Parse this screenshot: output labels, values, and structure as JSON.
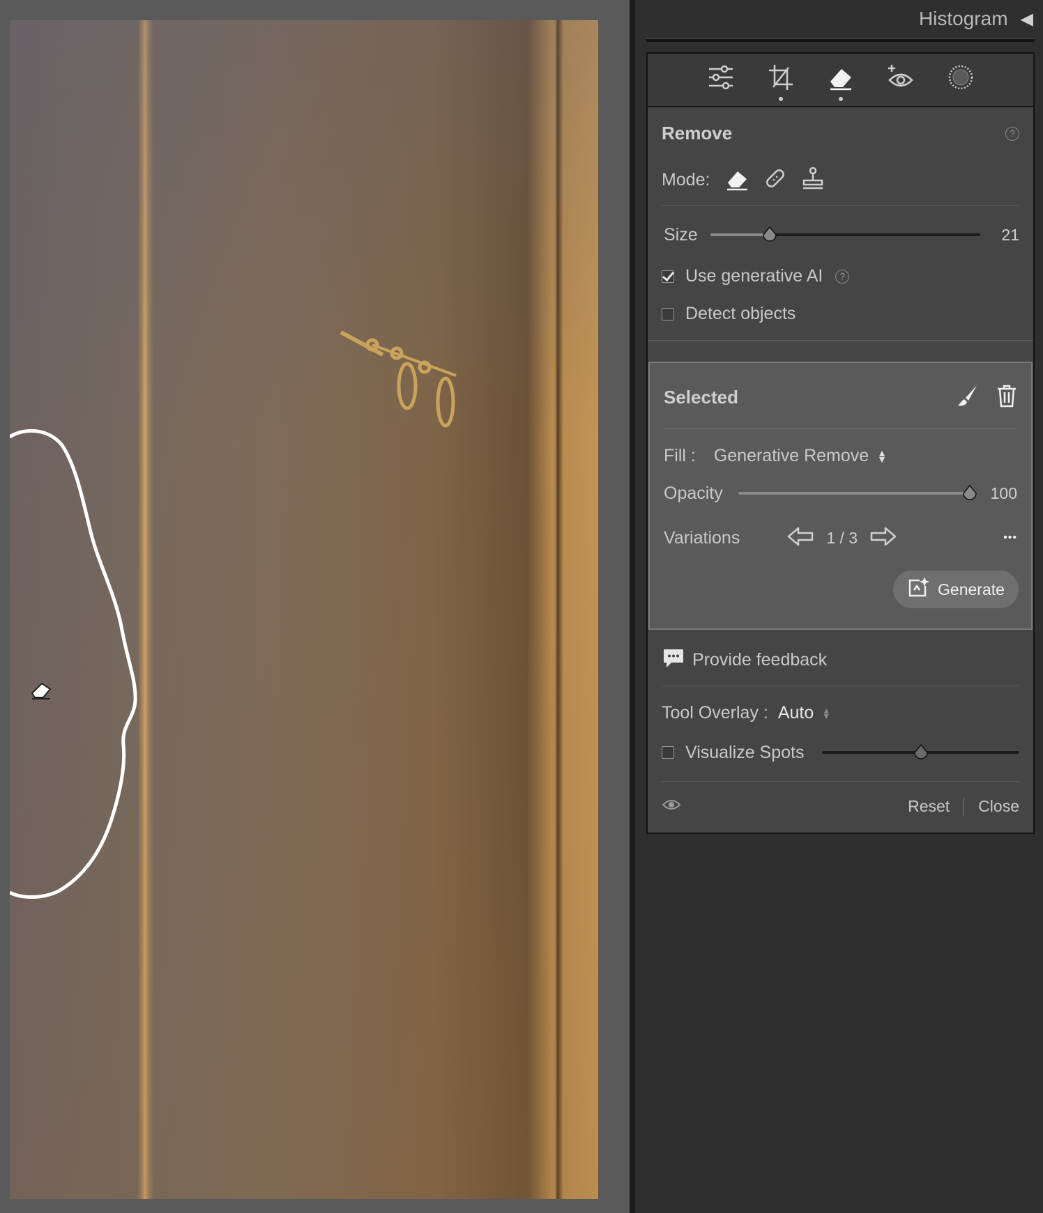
{
  "histogram": {
    "title": "Histogram",
    "collapse_glyph": "◀"
  },
  "tools": [
    {
      "name": "edit-sliders-icon",
      "active": false,
      "dot": false
    },
    {
      "name": "crop-icon",
      "active": false,
      "dot": true
    },
    {
      "name": "remove-eraser-icon",
      "active": true,
      "dot": true
    },
    {
      "name": "red-eye-icon",
      "active": false,
      "dot": false
    },
    {
      "name": "masking-icon",
      "active": false,
      "dot": false
    }
  ],
  "remove": {
    "title": "Remove",
    "mode_label": "Mode:",
    "modes": [
      "eraser-icon",
      "heal-bandage-icon",
      "clone-stamp-icon"
    ],
    "size_label": "Size",
    "size_value": "21",
    "size_fraction": 0.22,
    "use_gen_ai_label": "Use generative AI",
    "use_gen_ai_checked": true,
    "detect_objects_label": "Detect objects",
    "detect_objects_checked": false
  },
  "selected": {
    "title": "Selected",
    "fill_label": "Fill :",
    "fill_value": "Generative Remove",
    "opacity_label": "Opacity",
    "opacity_value": "100",
    "opacity_fraction": 1.0,
    "variations_label": "Variations",
    "variations_value": "1 / 3",
    "more_glyph": "•••",
    "generate_label": "Generate"
  },
  "feedback": {
    "label": "Provide feedback"
  },
  "overlay": {
    "label": "Tool Overlay :",
    "value": "Auto",
    "visualize_label": "Visualize Spots",
    "visualize_checked": false,
    "visualize_fraction": 0.5
  },
  "footer": {
    "reset_label": "Reset",
    "close_label": "Close"
  },
  "colors": {
    "panel_bg": "#454545",
    "selected_bg": "#5a5a5a",
    "app_bg": "#2f2f2f"
  }
}
